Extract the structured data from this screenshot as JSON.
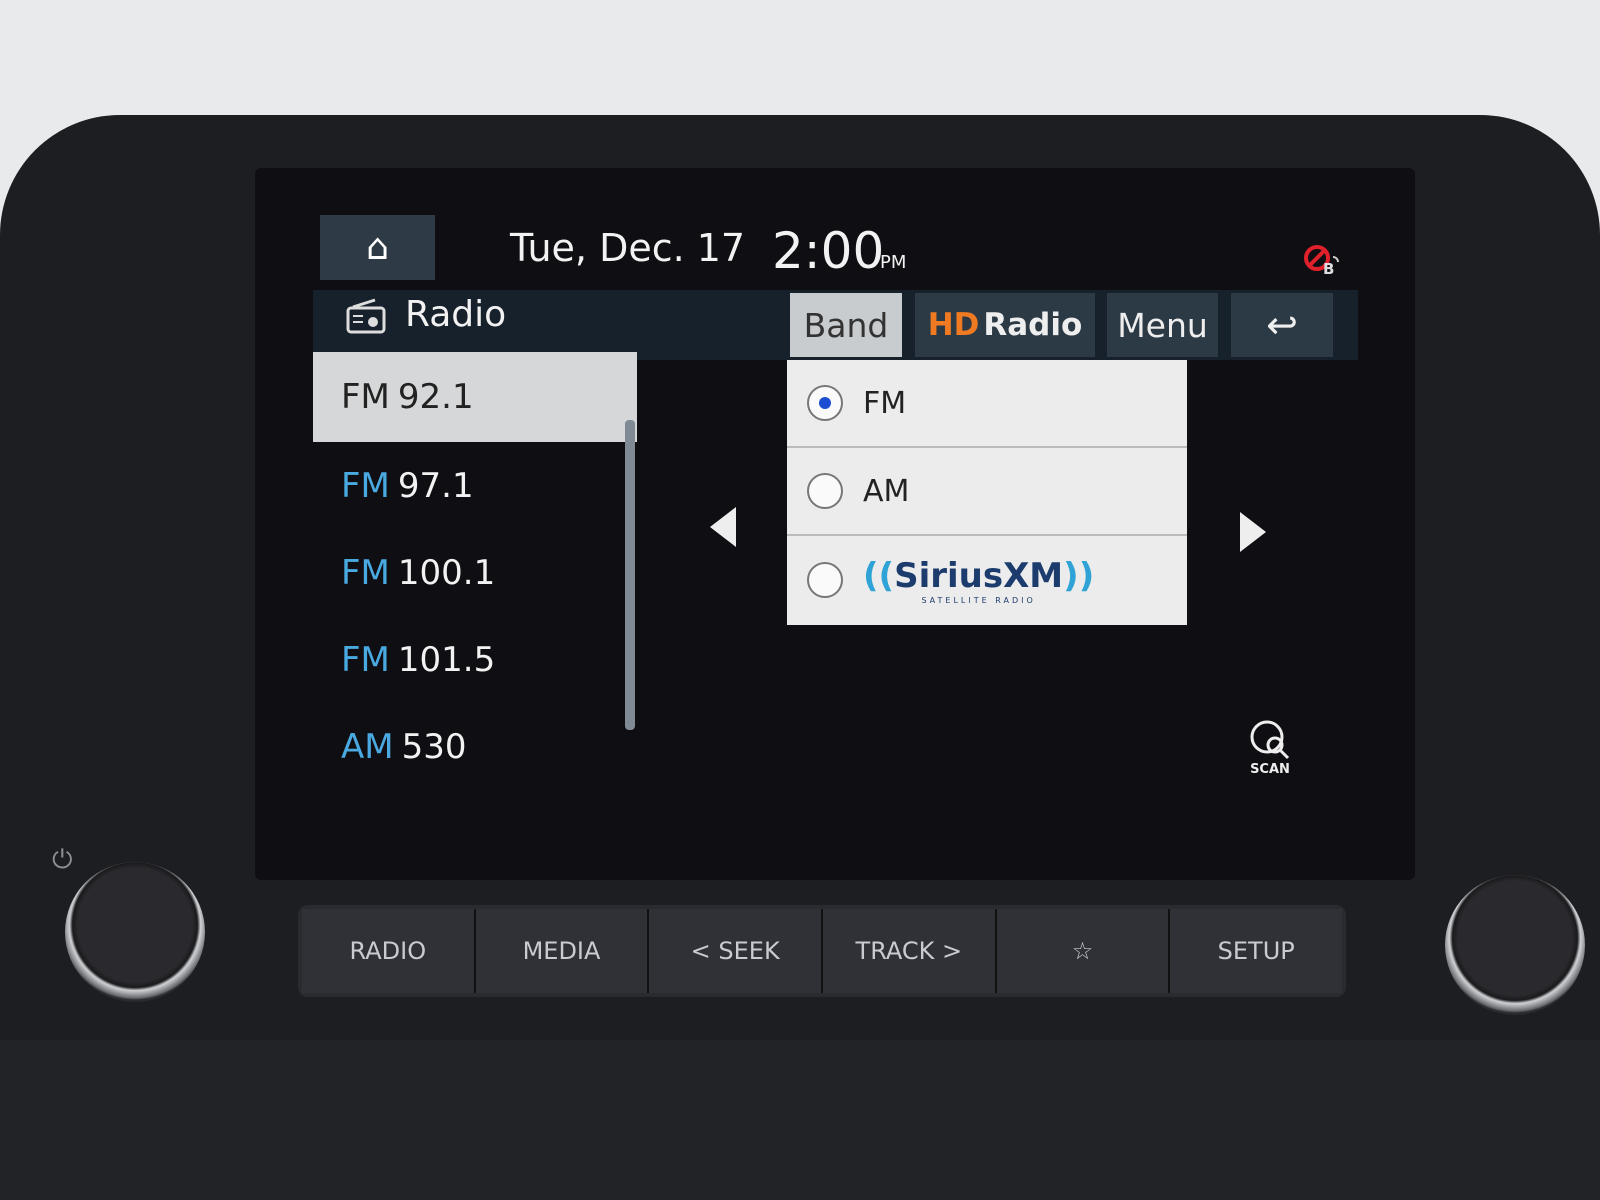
{
  "header": {
    "date": "Tue, Dec. 17",
    "time": "2:00",
    "ampm": "PM",
    "home_icon": "home-icon",
    "bluetooth_status_icon": "bluetooth-disconnected-icon"
  },
  "titlebar": {
    "title": "Radio",
    "band": "Band",
    "hd_radio": "Radio",
    "hd_prefix": "HD",
    "menu": "Menu",
    "back_icon": "back-arrow-icon"
  },
  "stations": [
    {
      "band": "FM",
      "freq": "92.1",
      "selected": true
    },
    {
      "band": "FM",
      "freq": "97.1"
    },
    {
      "band": "FM",
      "freq": "100.1"
    },
    {
      "band": "FM",
      "freq": "101.5"
    },
    {
      "band": "AM",
      "freq": "530"
    }
  ],
  "band_popup": {
    "options": [
      {
        "label": "FM",
        "selected": true
      },
      {
        "label": "AM",
        "selected": false
      },
      {
        "label": "SiriusXM",
        "selected": false
      }
    ],
    "sxm_word1": "Sirius",
    "sxm_word2": "XM",
    "sxm_tagline": "SATELLITE RADIO"
  },
  "scan": {
    "label": "SCAN"
  },
  "hardkeys": {
    "radio": "RADIO",
    "media": "MEDIA",
    "seek": "< SEEK",
    "track": "TRACK >",
    "favorite": "☆",
    "setup": "SETUP"
  },
  "colors": {
    "accent_blue": "#49a9e0",
    "hd_orange": "#f07a22",
    "bt_red": "#e0202a"
  }
}
